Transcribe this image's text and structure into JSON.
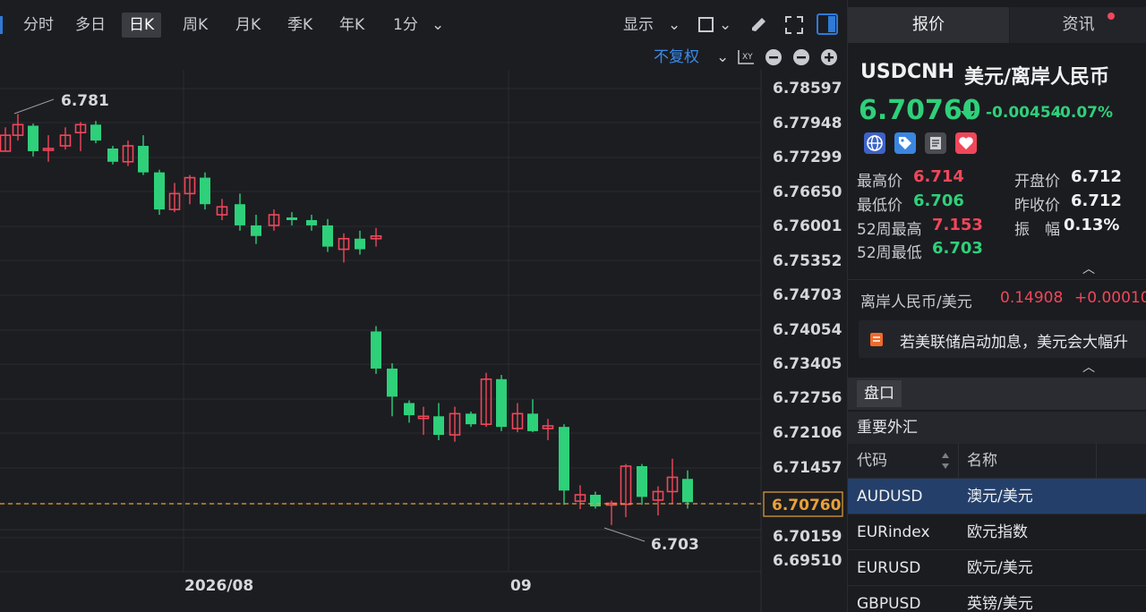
{
  "toolbar": {
    "timeframes": [
      "分时",
      "多日",
      "日K",
      "周K",
      "月K",
      "季K",
      "年K",
      "1分"
    ],
    "active": "日K",
    "display_label": "显示"
  },
  "sub_toolbar": {
    "adjust_label": "不复权"
  },
  "chart_data": {
    "type": "candlestick",
    "y_ticks": [
      "6.78597",
      "6.77948",
      "6.77299",
      "6.76650",
      "6.76001",
      "6.75352",
      "6.74703",
      "6.74054",
      "6.73405",
      "6.72756",
      "6.72106",
      "6.71457",
      "6.70760",
      "6.70159",
      "6.69510"
    ],
    "x_ticks": [
      "2026/08",
      "09"
    ],
    "high_annotation": "6.781",
    "low_annotation": "6.703",
    "current_price_label": "6.70760"
  },
  "right_panel": {
    "tabs": [
      "报价",
      "资讯"
    ],
    "symbol": "USDCNH",
    "symbol_name": "美元/离岸人民币",
    "price": "6.70760",
    "change": "-0.00454",
    "change_pct": "-0.07%",
    "stats": {
      "high_label": "最高价",
      "high": "6.714",
      "open_label": "开盘价",
      "open": "6.712",
      "low_label": "最低价",
      "low": "6.706",
      "prev_label": "昨收价",
      "prev": "6.712",
      "w52h_label": "52周最高",
      "w52h": "7.153",
      "amp_label": "振　幅",
      "amp": "0.13%",
      "w52l_label": "52周最低",
      "w52l": "6.703"
    },
    "related": {
      "name": "离岸人民币/美元",
      "price": "0.14908",
      "change": "+0.00010"
    },
    "news": "若美联储启动加息，美元会大幅升",
    "pankou_label": "盘口",
    "fx_title": "重要外汇",
    "table_headers": {
      "code": "代码",
      "name": "名称"
    },
    "rows": [
      {
        "code": "AUDUSD",
        "name": "澳元/美元"
      },
      {
        "code": "EURindex",
        "name": "欧元指数"
      },
      {
        "code": "EURUSD",
        "name": "欧元/美元"
      },
      {
        "code": "GBPUSD",
        "name": "英镑/美元"
      }
    ],
    "colors": {
      "up": "#f0475a",
      "down": "#2fd07a",
      "accent": "#2f7ad8"
    }
  }
}
